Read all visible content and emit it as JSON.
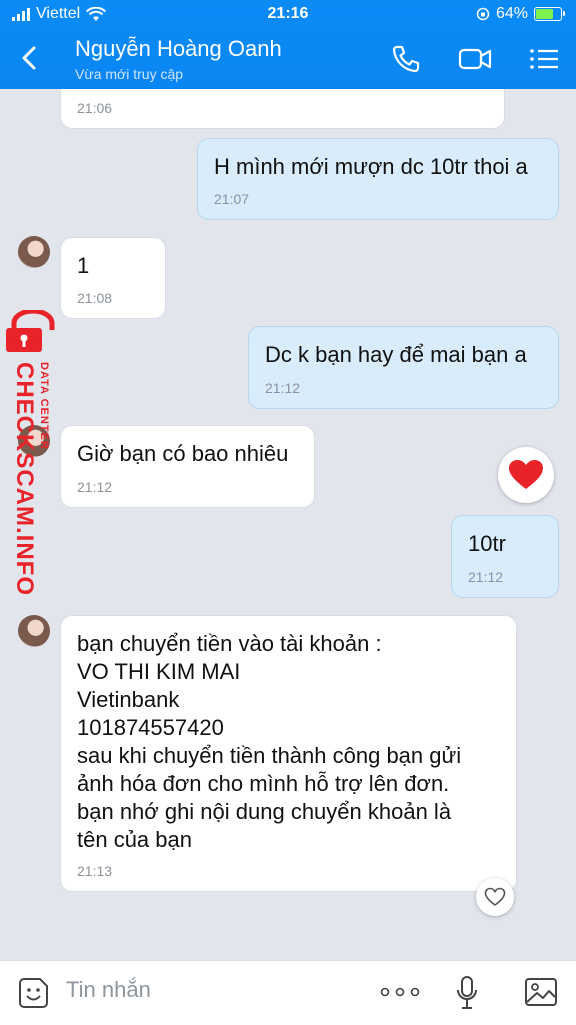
{
  "status": {
    "carrier": "Viettel",
    "time": "21:16",
    "battery": "64%",
    "battery_level": 0.64
  },
  "header": {
    "contact_name": "Nguyễn Hoàng Oanh",
    "subtitle": "Vừa mới truy cập"
  },
  "messages": [
    {
      "dir": "in",
      "text": "",
      "time": "21:06"
    },
    {
      "dir": "out",
      "text": "H mình mới mượn dc 10tr thoi a",
      "time": "21:07"
    },
    {
      "dir": "in",
      "text": "1",
      "time": "21:08"
    },
    {
      "dir": "out",
      "text": "Dc k bạn hay để mai bạn a",
      "time": "21:12"
    },
    {
      "dir": "in",
      "text": "Giờ bạn có bao nhiêu",
      "time": "21:12"
    },
    {
      "dir": "out",
      "text": "10tr",
      "time": "21:12"
    },
    {
      "dir": "in",
      "text": "bạn chuyển tiền vào tài khoản :\nVO THI KIM MAI\nVietinbank\n101874557420\n sau khi chuyển tiền thành công bạn gửi\nảnh hóa đơn cho mình hỗ trợ lên đơn.\nbạn nhớ ghi nội dung chuyển khoản là\ntên của bạn",
      "time": "21:13"
    }
  ],
  "watermark": {
    "brand": "CHECKSCAM.INFO",
    "tag": "DATA CENTER"
  },
  "input": {
    "placeholder": "Tin nhắn"
  },
  "colors": {
    "header": "#0a8bf6",
    "heart": "#e8232a",
    "out_bubble": "#d8ecfb"
  }
}
